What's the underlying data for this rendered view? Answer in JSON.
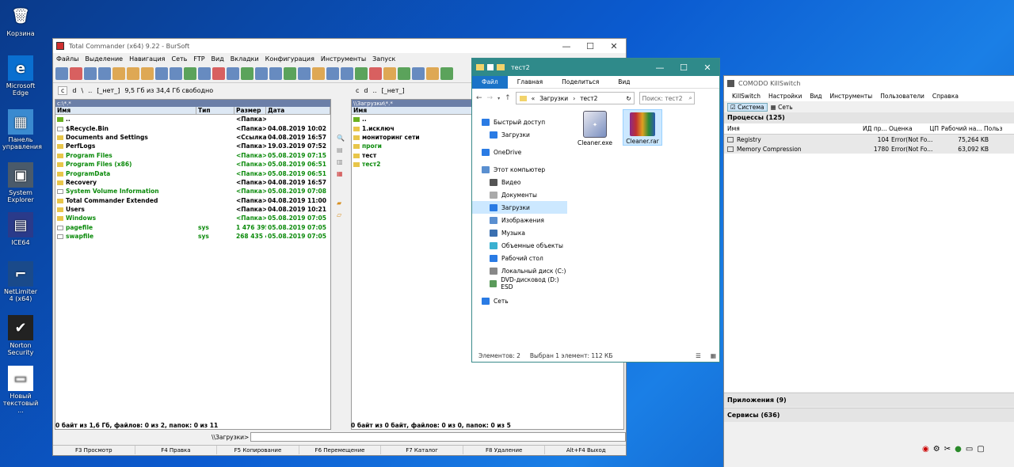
{
  "desktop": {
    "icons": [
      {
        "label": "Корзина",
        "glyph": "🗑"
      },
      {
        "label": "Microsoft Edge",
        "glyph": "e"
      },
      {
        "label": "Панель управления",
        "glyph": "▦"
      },
      {
        "label": "System Explorer",
        "glyph": "▣"
      },
      {
        "label": "ICE64",
        "glyph": "▤"
      },
      {
        "label": "NetLimiter 4 (x64)",
        "glyph": "⌐"
      },
      {
        "label": "Norton Security",
        "glyph": "✔"
      },
      {
        "label": "Новый текстовый ...",
        "glyph": "▭"
      }
    ]
  },
  "tc": {
    "title": "Total Commander (x64) 9.22 - BurSoft",
    "menu": [
      "Файлы",
      "Выделение",
      "Навигация",
      "Сеть",
      "FTP",
      "Вид",
      "Вкладки",
      "Конфигурация",
      "Инструменты",
      "Запуск"
    ],
    "left": {
      "drive": "c",
      "drive2": "d",
      "net": "\\",
      "up": "..",
      "nettag": "[_нет_]",
      "freespace": "9,5 Гб из 34,4 Гб свободно",
      "path": "c:\\*.*",
      "cols": [
        "Имя",
        "Тип",
        "Размер",
        "Дата"
      ],
      "files": [
        {
          "name": "..",
          "type": "",
          "size": "<Папка>",
          "date": "",
          "color": "black"
        },
        {
          "name": "$Recycle.Bin",
          "type": "",
          "size": "<Папка>",
          "date": "04.08.2019 10:02",
          "color": "black"
        },
        {
          "name": "Documents and Settings",
          "type": "",
          "size": "<Ссылка>",
          "date": "04.08.2019 16:57",
          "color": "black"
        },
        {
          "name": "PerfLogs",
          "type": "",
          "size": "<Папка>",
          "date": "19.03.2019 07:52",
          "color": "black"
        },
        {
          "name": "Program Files",
          "type": "",
          "size": "<Папка>",
          "date": "05.08.2019 07:15",
          "color": "green"
        },
        {
          "name": "Program Files (x86)",
          "type": "",
          "size": "<Папка>",
          "date": "05.08.2019 06:51",
          "color": "green"
        },
        {
          "name": "ProgramData",
          "type": "",
          "size": "<Папка>",
          "date": "05.08.2019 06:51",
          "color": "green"
        },
        {
          "name": "Recovery",
          "type": "",
          "size": "<Папка>",
          "date": "04.08.2019 16:57",
          "color": "black"
        },
        {
          "name": "System Volume Information",
          "type": "",
          "size": "<Папка>",
          "date": "05.08.2019 07:08",
          "color": "green"
        },
        {
          "name": "Total Commander Extended",
          "type": "",
          "size": "<Папка>",
          "date": "04.08.2019 11:00",
          "color": "black"
        },
        {
          "name": "Users",
          "type": "",
          "size": "<Папка>",
          "date": "04.08.2019 10:21",
          "color": "black"
        },
        {
          "name": "Windows",
          "type": "",
          "size": "<Папка>",
          "date": "05.08.2019 07:05",
          "color": "green"
        },
        {
          "name": "pagefile",
          "type": "sys",
          "size": "1 476 395 008",
          "date": "05.08.2019 07:05",
          "color": "green"
        },
        {
          "name": "swapfile",
          "type": "sys",
          "size": "268 435 456",
          "date": "05.08.2019 07:05",
          "color": "green"
        }
      ],
      "status": "0 байт из 1,6 Гб, файлов: 0 из 2, папок: 0 из 11"
    },
    "right": {
      "drive": "c",
      "drive2": "d",
      "up": "..",
      "nettag": "[_нет_]",
      "path": "\\\\Загрузки\\*.*",
      "cols": [
        "Имя"
      ],
      "files": [
        {
          "name": "..",
          "color": "black"
        },
        {
          "name": "1.исключ",
          "color": "black"
        },
        {
          "name": "мониторинг сети",
          "color": "black"
        },
        {
          "name": "проги",
          "color": "green"
        },
        {
          "name": "тест",
          "color": "black"
        },
        {
          "name": "тест2",
          "color": "green"
        }
      ],
      "status": "0 байт из 0 байт, файлов: 0 из 0, папок: 0 из 5"
    },
    "cmdpath": "\\\\Загрузки>",
    "fkeys": [
      "F3 Просмотр",
      "F4 Правка",
      "F5 Копирование",
      "F6 Перемещение",
      "F7 Каталог",
      "F8 Удаление",
      "Alt+F4 Выход"
    ]
  },
  "explorer": {
    "title": "тест2",
    "tabs": [
      "Файл",
      "Главная",
      "Поделиться",
      "Вид"
    ],
    "breadcrumb_prefix": "«",
    "breadcrumb": [
      "Загрузки",
      "тест2"
    ],
    "search_placeholder": "Поиск: тест2",
    "nav": [
      {
        "label": "Быстрый доступ",
        "color": "#2a7be4",
        "indent": 0
      },
      {
        "label": "Загрузки",
        "color": "#2a7be4",
        "indent": 1
      },
      {
        "label": "OneDrive",
        "color": "#2a7be4",
        "indent": 0
      },
      {
        "label": "Этот компьютер",
        "color": "#5a8fd0",
        "indent": 0
      },
      {
        "label": "Видео",
        "color": "#555",
        "indent": 1
      },
      {
        "label": "Документы",
        "color": "#aaa",
        "indent": 1
      },
      {
        "label": "Загрузки",
        "color": "#2a7be4",
        "indent": 1
      },
      {
        "label": "Изображения",
        "color": "#5a8fd0",
        "indent": 1
      },
      {
        "label": "Музыка",
        "color": "#3a6fb0",
        "indent": 1
      },
      {
        "label": "Объемные объекты",
        "color": "#3ab0d0",
        "indent": 1
      },
      {
        "label": "Рабочий стол",
        "color": "#2a7be4",
        "indent": 1
      },
      {
        "label": "Локальный диск (C:)",
        "color": "#888",
        "indent": 1
      },
      {
        "label": "DVD-дисковод (D:) ESD",
        "color": "#5a9a5a",
        "indent": 1
      },
      {
        "label": "Сеть",
        "color": "#2a7be4",
        "indent": 0
      }
    ],
    "files": [
      {
        "name": "Cleaner.exe"
      },
      {
        "name": "Cleaner.rar"
      }
    ],
    "status_count": "Элементов: 2",
    "status_sel": "Выбран 1 элемент: 112 КБ"
  },
  "killswitch": {
    "title": "COMODO KillSwitch",
    "menu": [
      "KillSwitch",
      "Настройки",
      "Вид",
      "Инструменты",
      "Пользователи",
      "Справка"
    ],
    "tabs": [
      "Система",
      "Сеть"
    ],
    "processes_header": "Процессы (125)",
    "cols": [
      "Имя",
      "ИД пр...",
      "Оценка",
      "ЦП",
      "Рабочий на...",
      "Польз"
    ],
    "rows": [
      {
        "name": "Registry",
        "pid": "104",
        "rating": "Error(Not Fo...",
        "cpu": "",
        "mem": "75,264 KB"
      },
      {
        "name": "Memory Compression",
        "pid": "1780",
        "rating": "Error(Not Fo...",
        "cpu": "",
        "mem": "63,092 KB"
      }
    ],
    "apps_header": "Приложения (9)",
    "services_header": "Сервисы (636)"
  }
}
